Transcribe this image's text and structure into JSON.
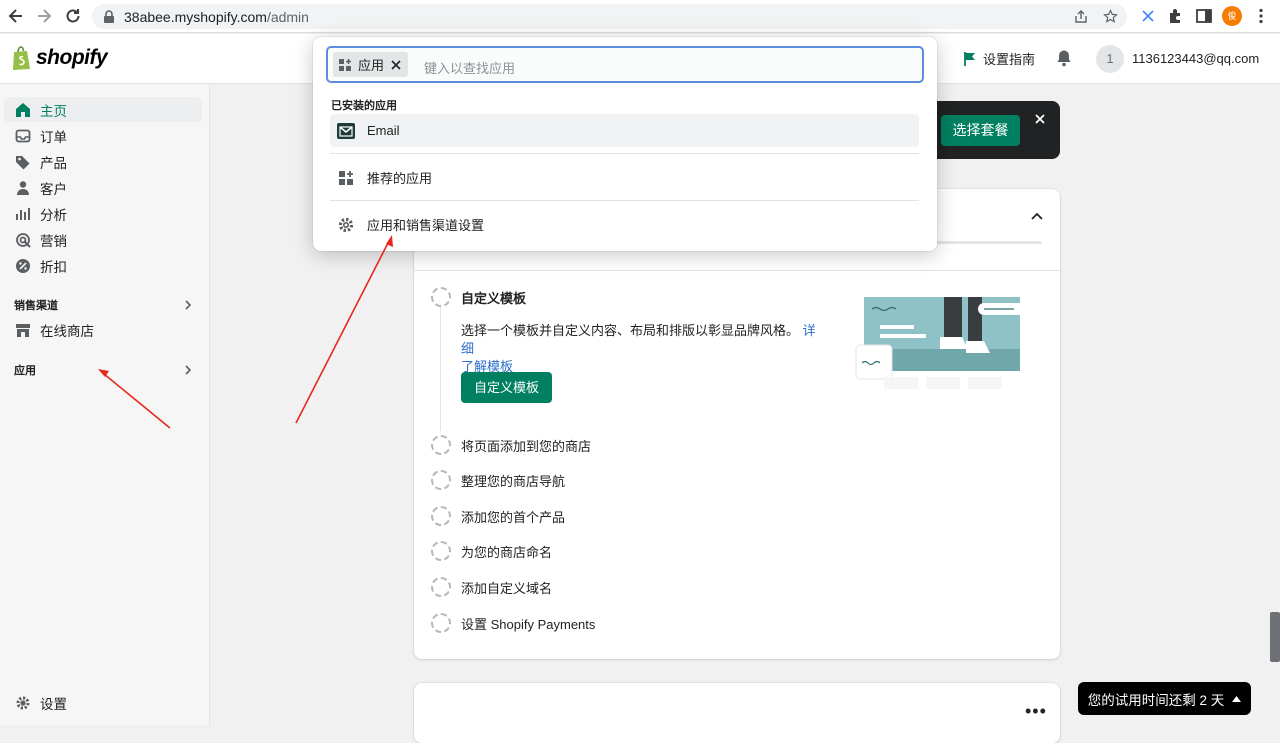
{
  "browser": {
    "url_host": "38abee.myshopify.com",
    "url_path": "/admin",
    "profile_initial": "俊"
  },
  "topbar": {
    "logo_text": "shopify",
    "setup_guide": "设置指南",
    "avatar_initial": "1",
    "account_email": "1136123443@qq.com"
  },
  "sidebar": {
    "items": [
      {
        "label": "主页",
        "icon": "home-icon"
      },
      {
        "label": "订单",
        "icon": "inbox-icon"
      },
      {
        "label": "产品",
        "icon": "tag-icon"
      },
      {
        "label": "客户",
        "icon": "person-icon"
      },
      {
        "label": "分析",
        "icon": "bar-chart-icon"
      },
      {
        "label": "营销",
        "icon": "target-icon"
      },
      {
        "label": "折扣",
        "icon": "discount-icon"
      }
    ],
    "sales_channels_label": "销售渠道",
    "online_store": "在线商店",
    "apps_label": "应用",
    "settings": "设置"
  },
  "banner": {
    "plan_button": "选择套餐"
  },
  "setup_card": {
    "task_active_title": "自定义模板",
    "task_active_desc": "选择一个模板并自定义内容、布局和排版以彰显品牌风格。",
    "task_active_link_1": "详细",
    "task_active_link_2": "了解模板",
    "customize_button": "自定义模板",
    "tasks": [
      "将页面添加到您的商店",
      "整理您的商店导航",
      "添加您的首个产品",
      "为您的商店命名",
      "添加自定义域名",
      "设置 Shopify Payments"
    ]
  },
  "trial": {
    "text": "您的试用时间还剩 2 天"
  },
  "popover": {
    "search_tag": "应用",
    "search_placeholder": "键入以查找应用",
    "installed_section": "已安装的应用",
    "installed_app": "Email",
    "recommended": "推荐的应用",
    "settings_link": "应用和销售渠道设置"
  },
  "colors": {
    "accent": "#008060",
    "annotation_arrow": "#e8281c",
    "focus_ring": "#5c8ddc"
  }
}
